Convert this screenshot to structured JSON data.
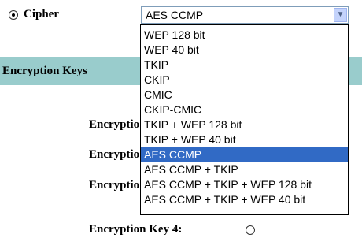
{
  "cipher": {
    "label": "Cipher",
    "selected_value": "AES CCMP",
    "options": [
      "WEP 128 bit",
      "WEP 40 bit",
      "TKIP",
      "CKIP",
      "CMIC",
      "CKIP-CMIC",
      "TKIP + WEP 128 bit",
      "TKIP + WEP 40 bit",
      "AES CCMP",
      "AES CCMP + TKIP",
      "AES CCMP + TKIP + WEP 128 bit",
      "AES CCMP + TKIP + WEP 40 bit"
    ],
    "highlighted_index": 8
  },
  "section": {
    "title": "Encryption Keys"
  },
  "keys": [
    {
      "label": "Encryptio"
    },
    {
      "label": "Encryptio"
    },
    {
      "label": "Encryptio"
    },
    {
      "label": "Encryption Key 4:"
    }
  ],
  "colors": {
    "section_bar": "#99cccc",
    "highlight": "#316ac5"
  }
}
